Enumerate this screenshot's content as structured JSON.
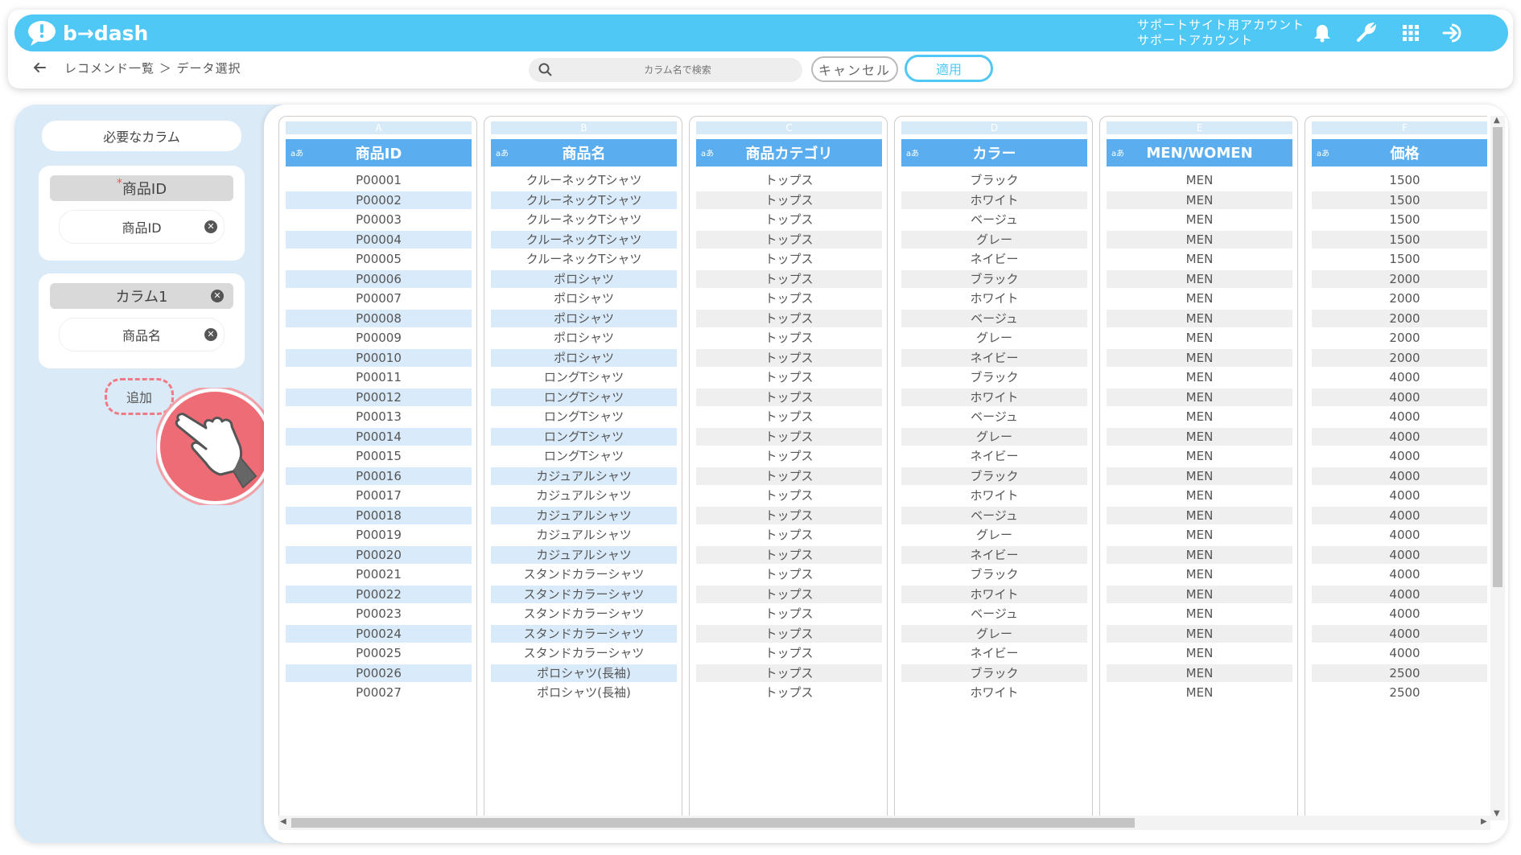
{
  "app": {
    "logo_text": "b→dash"
  },
  "header": {
    "account_line1": "サポートサイト用アカウント",
    "account_line2": "サポートアカウント",
    "icons": [
      "bell-icon",
      "wrench-icon",
      "apps-grid-icon",
      "logout-icon"
    ]
  },
  "nav": {
    "breadcrumb": "レコメンド一覧 ＞ データ選択",
    "search_placeholder": "カラム名で検索",
    "cancel_label": "キャンセル",
    "apply_label": "適用"
  },
  "left": {
    "required_label": "必要なカラム",
    "required_mark": "*",
    "group1": {
      "title": "商品ID",
      "item": "商品ID"
    },
    "group2": {
      "title": "カラム1",
      "item": "商品名"
    },
    "add_label": "追加"
  },
  "table": {
    "type_badge": "aあ",
    "columns": [
      {
        "letter": "A",
        "name": "商品ID"
      },
      {
        "letter": "B",
        "name": "商品名"
      },
      {
        "letter": "C",
        "name": "商品カテゴリ"
      },
      {
        "letter": "D",
        "name": "カラー"
      },
      {
        "letter": "E",
        "name": "MEN/WOMEN"
      },
      {
        "letter": "F",
        "name": "価格"
      }
    ],
    "rows": [
      [
        "P00001",
        "クルーネックTシャツ",
        "トップス",
        "ブラック",
        "MEN",
        "1500"
      ],
      [
        "P00002",
        "クルーネックTシャツ",
        "トップス",
        "ホワイト",
        "MEN",
        "1500"
      ],
      [
        "P00003",
        "クルーネックTシャツ",
        "トップス",
        "ベージュ",
        "MEN",
        "1500"
      ],
      [
        "P00004",
        "クルーネックTシャツ",
        "トップス",
        "グレー",
        "MEN",
        "1500"
      ],
      [
        "P00005",
        "クルーネックTシャツ",
        "トップス",
        "ネイビー",
        "MEN",
        "1500"
      ],
      [
        "P00006",
        "ポロシャツ",
        "トップス",
        "ブラック",
        "MEN",
        "2000"
      ],
      [
        "P00007",
        "ポロシャツ",
        "トップス",
        "ホワイト",
        "MEN",
        "2000"
      ],
      [
        "P00008",
        "ポロシャツ",
        "トップス",
        "ベージュ",
        "MEN",
        "2000"
      ],
      [
        "P00009",
        "ポロシャツ",
        "トップス",
        "グレー",
        "MEN",
        "2000"
      ],
      [
        "P00010",
        "ポロシャツ",
        "トップス",
        "ネイビー",
        "MEN",
        "2000"
      ],
      [
        "P00011",
        "ロングTシャツ",
        "トップス",
        "ブラック",
        "MEN",
        "4000"
      ],
      [
        "P00012",
        "ロングTシャツ",
        "トップス",
        "ホワイト",
        "MEN",
        "4000"
      ],
      [
        "P00013",
        "ロングTシャツ",
        "トップス",
        "ベージュ",
        "MEN",
        "4000"
      ],
      [
        "P00014",
        "ロングTシャツ",
        "トップス",
        "グレー",
        "MEN",
        "4000"
      ],
      [
        "P00015",
        "ロングTシャツ",
        "トップス",
        "ネイビー",
        "MEN",
        "4000"
      ],
      [
        "P00016",
        "カジュアルシャツ",
        "トップス",
        "ブラック",
        "MEN",
        "4000"
      ],
      [
        "P00017",
        "カジュアルシャツ",
        "トップス",
        "ホワイト",
        "MEN",
        "4000"
      ],
      [
        "P00018",
        "カジュアルシャツ",
        "トップス",
        "ベージュ",
        "MEN",
        "4000"
      ],
      [
        "P00019",
        "カジュアルシャツ",
        "トップス",
        "グレー",
        "MEN",
        "4000"
      ],
      [
        "P00020",
        "カジュアルシャツ",
        "トップス",
        "ネイビー",
        "MEN",
        "4000"
      ],
      [
        "P00021",
        "スタンドカラーシャツ",
        "トップス",
        "ブラック",
        "MEN",
        "4000"
      ],
      [
        "P00022",
        "スタンドカラーシャツ",
        "トップス",
        "ホワイト",
        "MEN",
        "4000"
      ],
      [
        "P00023",
        "スタンドカラーシャツ",
        "トップス",
        "ベージュ",
        "MEN",
        "4000"
      ],
      [
        "P00024",
        "スタンドカラーシャツ",
        "トップス",
        "グレー",
        "MEN",
        "4000"
      ],
      [
        "P00025",
        "スタンドカラーシャツ",
        "トップス",
        "ネイビー",
        "MEN",
        "4000"
      ],
      [
        "P00026",
        "ポロシャツ(長袖)",
        "トップス",
        "ブラック",
        "MEN",
        "2500"
      ],
      [
        "P00027",
        "ポロシャツ(長袖)",
        "トップス",
        "ホワイト",
        "MEN",
        "2500"
      ]
    ],
    "highlight_columns": [
      0,
      1
    ]
  },
  "colors": {
    "brand": "#4fc8f5",
    "header_col": "#5aaef0",
    "accent_dashed": "#ef7a85",
    "hand_circle": "#ee6c76"
  }
}
